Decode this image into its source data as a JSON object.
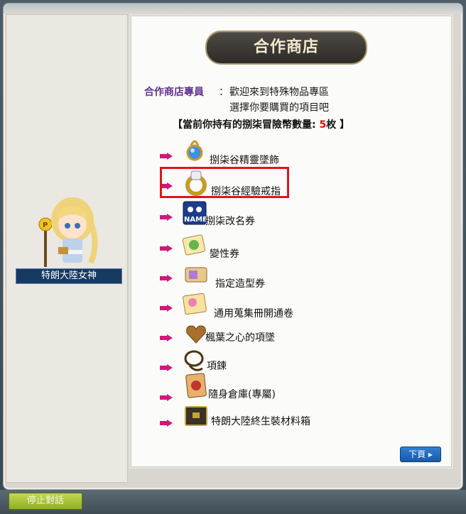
{
  "title": "合作商店",
  "npc": {
    "name": "特朗大陸女神"
  },
  "dialog": {
    "speaker": "合作商店專員",
    "colon": "：",
    "greeting_line1": "歡迎來到特殊物品專區",
    "greeting_line2": "選擇你要購買的項目吧",
    "coins_prefix": "【當前你持有的捌柒冒險幣數量: ",
    "coins_value": "5",
    "coins_suffix": "枚 】"
  },
  "items": [
    {
      "label": "捌柒谷精靈墜飾",
      "icon": "pendant-icon"
    },
    {
      "label": "捌柒谷經驗戒指",
      "icon": "ring-icon",
      "highlighted": true
    },
    {
      "label": "捌柒改名券",
      "icon": "name-ticket-icon"
    },
    {
      "label": "變性券",
      "icon": "gender-ticket-icon"
    },
    {
      "label": "指定造型券",
      "icon": "style-ticket-icon"
    },
    {
      "label": "通用蒐集冊開通卷",
      "icon": "collection-book-icon"
    },
    {
      "label": "楓葉之心的項墜",
      "icon": "heart-pendant-icon"
    },
    {
      "label": "項鍊",
      "icon": "necklace-icon"
    },
    {
      "label": "隨身倉庫(專屬)",
      "icon": "storage-icon"
    },
    {
      "label": "特朗大陸終生裝材料箱",
      "icon": "treasure-box-icon"
    }
  ],
  "buttons": {
    "next": "下頁 ▸",
    "stop": "停止對話"
  },
  "colors": {
    "speaker": "#623190",
    "coins_value": "#e01010",
    "highlight": "#e0141e",
    "arrow": "#d0187a"
  }
}
